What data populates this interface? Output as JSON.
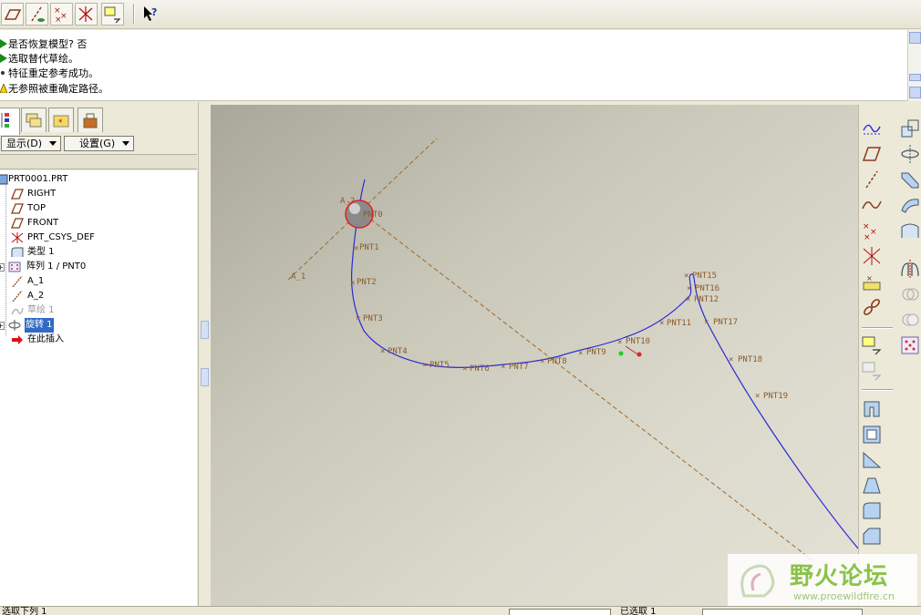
{
  "toolbar": {
    "buttons": [
      {
        "name": "datum-plane-display-icon"
      },
      {
        "name": "datum-axis-display-icon"
      },
      {
        "name": "datum-point-display-icon"
      },
      {
        "name": "coordinate-system-display-icon"
      },
      {
        "name": "annotation-display-icon"
      },
      {
        "name": "context-help-icon"
      }
    ]
  },
  "messages": [
    {
      "text": "是否恢复模型?   否",
      "type": "prompt"
    },
    {
      "text": "选取替代草绘。",
      "type": "prompt"
    },
    {
      "text": "特征重定参考成功。",
      "type": "info"
    },
    {
      "text": "无参照被重确定路径。",
      "type": "warning"
    }
  ],
  "left_panel": {
    "show_menu": "显示(D)",
    "settings_menu": "设置(G)",
    "tree": [
      {
        "label": "PRT0001.PRT",
        "icon": "part-icon",
        "state": "normal"
      },
      {
        "label": "RIGHT",
        "icon": "datum-plane-icon",
        "state": "normal"
      },
      {
        "label": "TOP",
        "icon": "datum-plane-icon",
        "state": "normal"
      },
      {
        "label": "FRONT",
        "icon": "datum-plane-icon",
        "state": "normal"
      },
      {
        "label": "PRT_CSYS_DEF",
        "icon": "coordinate-system-icon",
        "state": "normal"
      },
      {
        "label": "类型 1",
        "icon": "datum-curve-icon",
        "state": "normal"
      },
      {
        "label": "阵列 1 / PNT0",
        "icon": "pattern-icon",
        "state": "normal"
      },
      {
        "label": "A_1",
        "icon": "datum-axis-icon",
        "state": "normal"
      },
      {
        "label": "A_2",
        "icon": "datum-axis-icon",
        "state": "normal"
      },
      {
        "label": "草绘 1",
        "icon": "sketch-icon",
        "state": "dim"
      },
      {
        "label": "旋转 1",
        "icon": "revolve-icon",
        "state": "selected"
      },
      {
        "label": "在此插入",
        "icon": "insert-here-icon",
        "state": "normal"
      }
    ]
  },
  "graphics": {
    "axis_label": "A_1",
    "axis_label_top": "A_2",
    "points": [
      "PNT0",
      "PNT1",
      "PNT2",
      "PNT3",
      "PNT4",
      "PNT5",
      "PNT6",
      "PNT7",
      "PNT8",
      "PNT9",
      "PNT10",
      "PNT11",
      "PNT12",
      "PNT16",
      "PNT15",
      "PNT17",
      "PNT18",
      "PNT19"
    ]
  },
  "right_toolbar": {
    "col1": [
      "sketched-datum-curve-icon",
      "datum-plane-icon",
      "datum-axis-icon",
      "datum-curve-icon",
      "datum-point-icon",
      "coordinate-system-icon",
      "analysis-icon",
      "datum-chain-icon",
      "extrude-icon",
      "revolve-insert-icon",
      "shell-icon",
      "rib-icon",
      "draft-icon",
      "round-icon",
      "chamfer-icon",
      "mirror-tool-icon"
    ],
    "col2": [
      "scale-icon",
      "revolve-icon",
      "sweep-icon",
      "blend-icon",
      "boundary-icon",
      "merge-icon",
      "trim-icon",
      "offset-icon",
      "thicken-icon",
      "pattern-grid-icon"
    ]
  },
  "watermark": {
    "brand": "野火论坛",
    "url": "www.proewildfire.cn"
  },
  "status": {
    "left": "选取下列 1",
    "middle": "已选取 1"
  }
}
